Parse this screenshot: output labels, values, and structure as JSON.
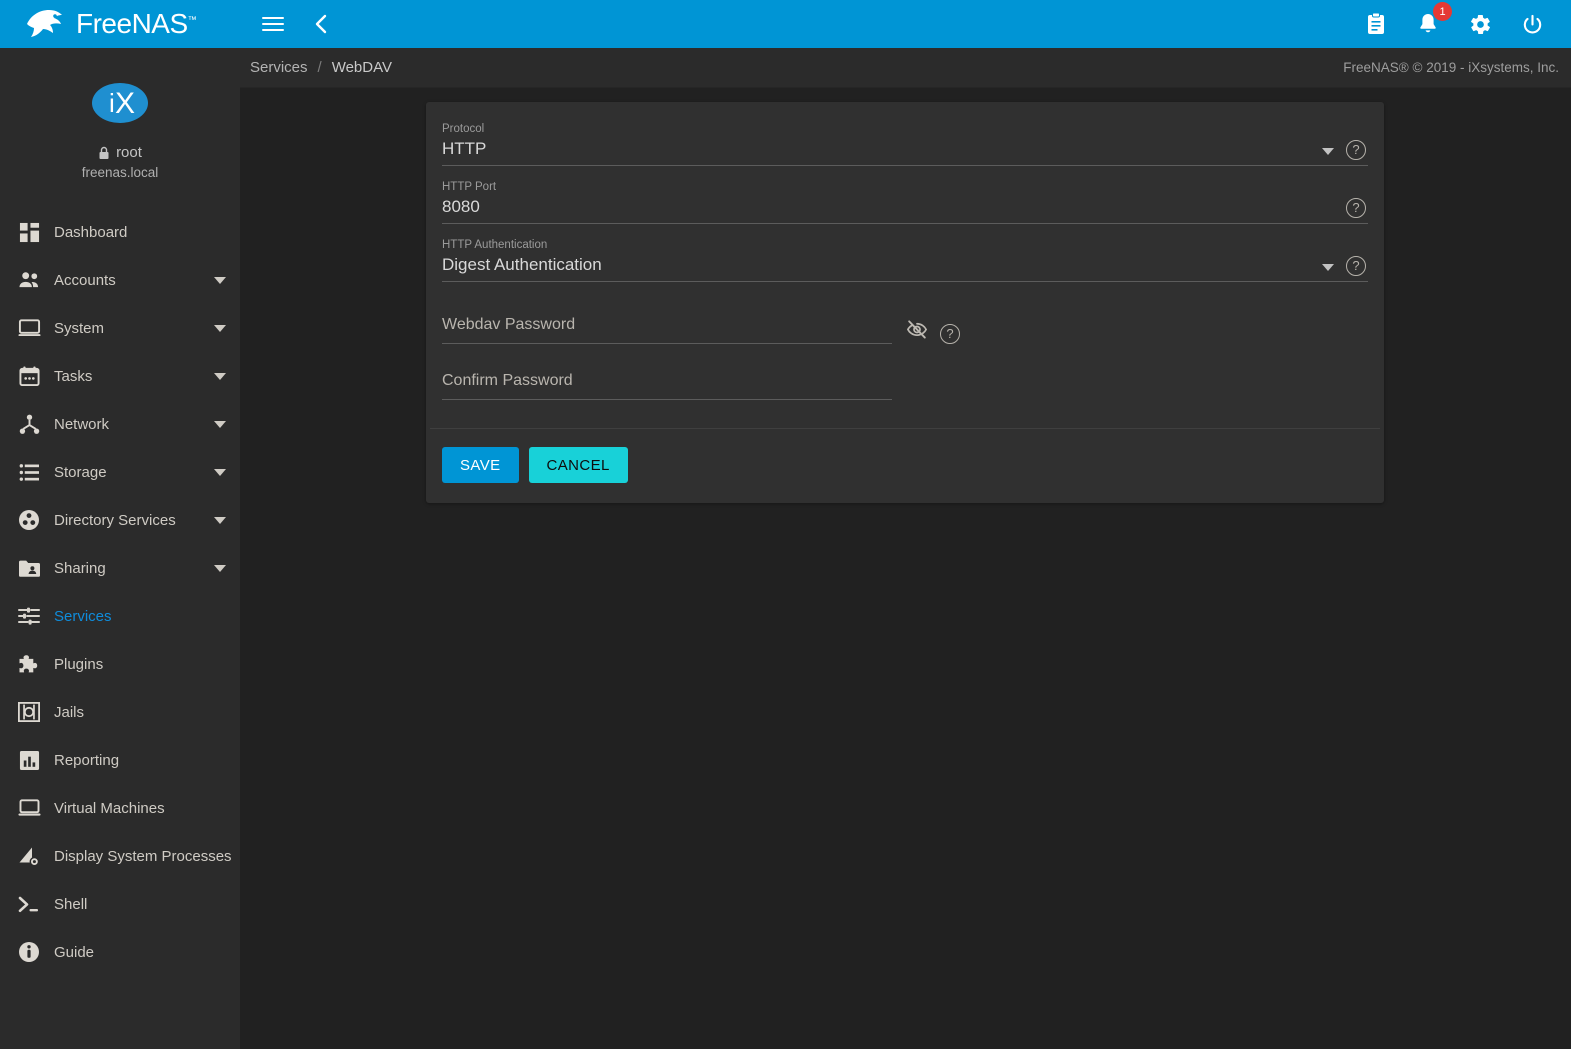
{
  "brand": {
    "name": "FreeNAS",
    "tm": "™",
    "logo_icon": "freenas-fish-logo"
  },
  "topbar": {
    "menu_icon": "hamburger-menu-icon",
    "back_icon": "chevron-left-icon",
    "actions": [
      {
        "name": "tasks-manager-icon",
        "icon": "clipboard-icon"
      },
      {
        "name": "notifications-icon",
        "icon": "bell-icon",
        "badge": "1"
      },
      {
        "name": "settings-icon",
        "icon": "gear-icon"
      },
      {
        "name": "power-icon",
        "icon": "power-icon"
      }
    ]
  },
  "breadcrumb": {
    "items": [
      "Services",
      "WebDAV"
    ],
    "separator": "/",
    "copyright": "FreeNAS® © 2019 - iXsystems, Inc."
  },
  "sidebar": {
    "avatar_text": "iX",
    "lock_icon": "lock-icon",
    "username": "root",
    "hostname": "freenas.local",
    "items": [
      {
        "label": "Dashboard",
        "icon": "dashboard-icon",
        "expandable": false,
        "active": false
      },
      {
        "label": "Accounts",
        "icon": "accounts-people-icon",
        "expandable": true,
        "active": false
      },
      {
        "label": "System",
        "icon": "system-monitor-icon",
        "expandable": true,
        "active": false
      },
      {
        "label": "Tasks",
        "icon": "calendar-icon",
        "expandable": true,
        "active": false
      },
      {
        "label": "Network",
        "icon": "network-icon",
        "expandable": true,
        "active": false
      },
      {
        "label": "Storage",
        "icon": "storage-list-icon",
        "expandable": true,
        "active": false
      },
      {
        "label": "Directory Services",
        "icon": "directory-services-icon",
        "expandable": true,
        "active": false
      },
      {
        "label": "Sharing",
        "icon": "sharing-folder-icon",
        "expandable": true,
        "active": false
      },
      {
        "label": "Services",
        "icon": "services-sliders-icon",
        "expandable": false,
        "active": true
      },
      {
        "label": "Plugins",
        "icon": "puzzle-piece-icon",
        "expandable": false,
        "active": false
      },
      {
        "label": "Jails",
        "icon": "jails-icon",
        "expandable": false,
        "active": false
      },
      {
        "label": "Reporting",
        "icon": "bar-chart-icon",
        "expandable": false,
        "active": false
      },
      {
        "label": "Virtual Machines",
        "icon": "laptop-icon",
        "expandable": false,
        "active": false
      },
      {
        "label": "Display System Processes",
        "icon": "processes-icon",
        "expandable": false,
        "active": false
      },
      {
        "label": "Shell",
        "icon": "terminal-prompt-icon",
        "expandable": false,
        "active": false
      },
      {
        "label": "Guide",
        "icon": "info-circle-icon",
        "expandable": false,
        "active": false
      }
    ]
  },
  "form": {
    "protocol": {
      "label": "Protocol",
      "value": "HTTP",
      "help_icon": "help-circle-icon",
      "arrow_icon": "dropdown-arrow-icon"
    },
    "http_port": {
      "label": "HTTP Port",
      "value": "8080",
      "help_icon": "help-circle-icon"
    },
    "http_auth": {
      "label": "HTTP Authentication",
      "value": "Digest Authentication",
      "help_icon": "help-circle-icon",
      "arrow_icon": "dropdown-arrow-icon"
    },
    "webdav_password": {
      "placeholder": "Webdav Password",
      "value": "",
      "eye_icon": "visibility-off-icon",
      "help_icon": "help-circle-icon"
    },
    "confirm_password": {
      "placeholder": "Confirm Password",
      "value": ""
    },
    "save_label": "SAVE",
    "cancel_label": "CANCEL"
  },
  "colors": {
    "accent": "#0095d5",
    "cancel": "#18d1d8",
    "badge": "#e53935",
    "active_nav": "#0f8cdb"
  }
}
